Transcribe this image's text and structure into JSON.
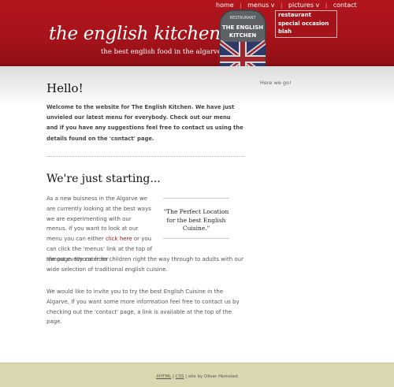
{
  "nav": {
    "home": "home",
    "menus": "menus v",
    "pictures": "pictures v",
    "contact": "contact",
    "separator": "|"
  },
  "dropdown": {
    "items": [
      "restaurant",
      "special occasion",
      "blah"
    ]
  },
  "header": {
    "logo": "the english kitchen",
    "tagline": "the best english food in the algarve",
    "badge_top": "RESTAURANT",
    "badge_main": "THE ENGLISH KITCHEN",
    "badge_bottom": "ALGARVE"
  },
  "sidebar": {
    "text": "Here we go!"
  },
  "main": {
    "heading1": "Hello!",
    "intro": "Welcome to the website for The English Kitchen. We have just unvieled our latest menu for everybody. Check out our menu and if you have any suggestions feel free to contact us using the details found on the 'contact' page.",
    "heading2": "We're just starting...",
    "col_text_a": "As a new buisness in the Algarve we are currently looking at the best ways we are experimenting with our menus. If you want to look at our menu you can either ",
    "click_here": "click here",
    "col_text_b": " or you can click the 'menus' link at the top of the page. We cater for",
    "full_text": "almost everyone from children right the way through to adults with our wide selection of traditional english cuisine.",
    "quote": "\"The Perfect Location for the best English Cuisine.\"",
    "para2": "We would like to invite you to try the best English Cuisine in the Algarve, If you want some more information feel free to contact us by checking out the 'contact' page, a link is available at the top of the page."
  },
  "footer": {
    "xhtml": "XHTML",
    "css": "CSS",
    "sep": "|",
    "credit": "site by Oliver Hemsted"
  },
  "colors": {
    "header_red": "#a5131a",
    "footer_bg": "#d9d7b0",
    "link_red": "#a5131a"
  }
}
